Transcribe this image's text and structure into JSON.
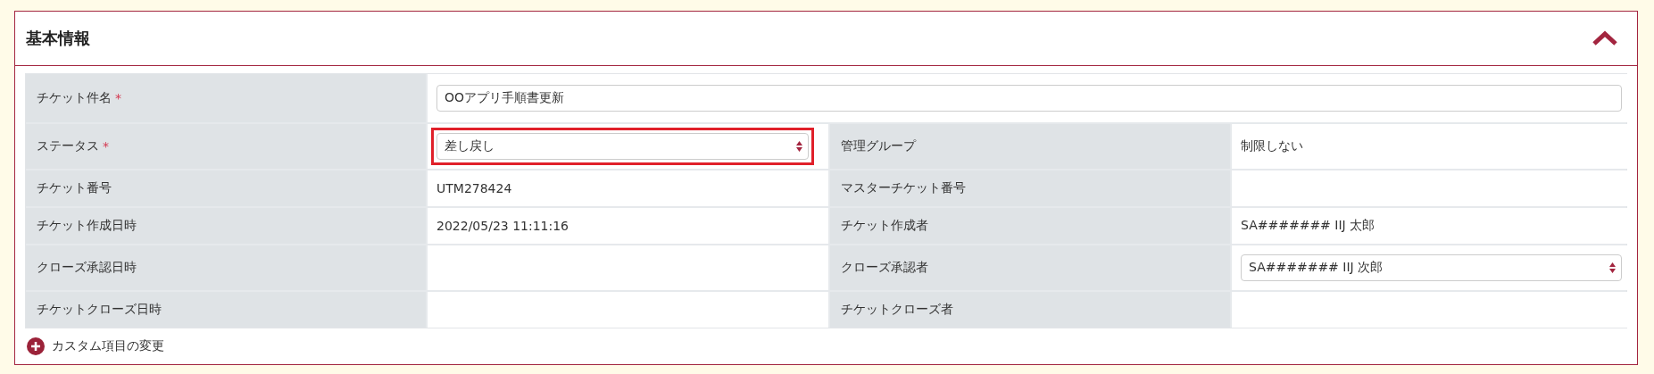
{
  "panel": {
    "title": "基本情報",
    "expanded": true
  },
  "rows": [
    [
      {
        "label": "チケット件名",
        "required_mark": "*",
        "kind": "input",
        "value": "OOアプリ手順書更新"
      }
    ],
    [
      {
        "label": "ステータス",
        "required_mark": "*",
        "kind": "select",
        "value": "差し戻し",
        "highlighted": true
      },
      {
        "label": "管理グループ",
        "kind": "text",
        "value": "制限しない"
      }
    ],
    [
      {
        "label": "チケット番号",
        "kind": "text",
        "value": "UTM278424"
      },
      {
        "label": "マスターチケット番号",
        "kind": "text"
      }
    ],
    [
      {
        "label": "チケット作成日時",
        "kind": "text",
        "value": "2022/05/23 11:11:16"
      },
      {
        "label": "チケット作成者",
        "kind": "text",
        "value": "SA####### IIJ 太郎"
      }
    ],
    [
      {
        "label": "クローズ承認日時",
        "kind": "text"
      },
      {
        "label": "クローズ承認者",
        "kind": "select",
        "value": "SA####### IIJ 次郎"
      }
    ],
    [
      {
        "label": "チケットクローズ日時",
        "kind": "text"
      },
      {
        "label": "チケットクローズ者",
        "kind": "text"
      }
    ]
  ],
  "custom_link": {
    "label": "カスタム項目の変更"
  }
}
